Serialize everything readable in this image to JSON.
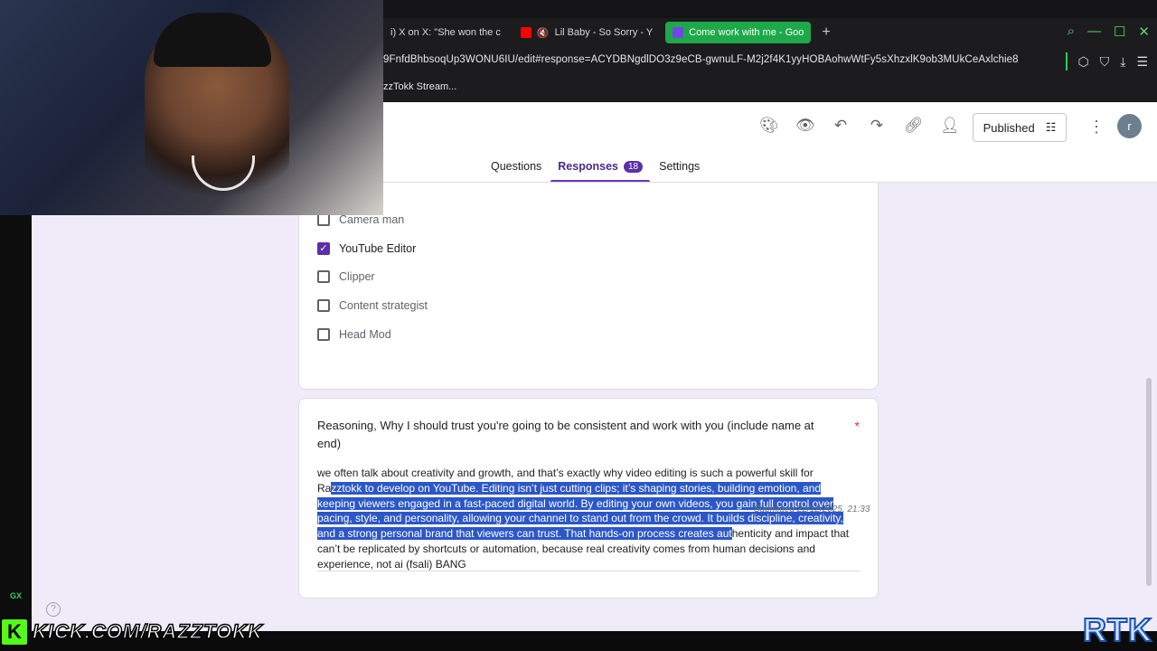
{
  "browser": {
    "tabs": [
      {
        "label": "i) X on X: \"She won the c",
        "active": false,
        "icon": "x-icon"
      },
      {
        "label": "Lil Baby - So Sorry - Y",
        "active": false,
        "icon": "youtube-icon",
        "muted": true
      },
      {
        "label": "Come work with me - Goo",
        "active": true,
        "icon": "forms-icon"
      }
    ],
    "new_tab": "+",
    "address": "9FnfdBhbsoqUp3WONU6IU/edit#response=ACYDBNgdlDO3z9eCB-gwnuLF-M2j2f4K1yyHOBAohwWtFy5sXhzxlK9ob3MUkCeAxlchie8",
    "bookmark": "zzTokk Stream...",
    "accent": "#1ea84a"
  },
  "form": {
    "published_label": "Published",
    "avatar_initial": "r",
    "tabs": [
      {
        "label": "Questions"
      },
      {
        "label": "Responses",
        "badge": "18",
        "active": true
      },
      {
        "label": "Settings"
      }
    ],
    "options": [
      {
        "label": "Camera man",
        "checked": false
      },
      {
        "label": "YouTube Editor",
        "checked": true
      },
      {
        "label": "Clipper",
        "checked": false
      },
      {
        "label": "Content strategist",
        "checked": false
      },
      {
        "label": "Head Mod",
        "checked": false
      }
    ],
    "question": "Reasoning, Why I should trust you're going to be consistent and work with you (include name at end)",
    "required_mark": "*",
    "answer_before": "we often talk about creativity and growth, and that’s exactly why video editing is such a powerful skill for Ra",
    "answer_selected": "zztokk to develop on YouTube. Editing isn’t just cutting clips; it’s shaping stories, building emotion, and keeping viewers engaged in a fast-paced digital world. By editing your own videos, you gain full control over pacing, style, and personality, allowing your channel to stand out from the crowd. It builds discipline, creativity, and a strong personal brand that viewers can trust. That hands-on process creates aut",
    "answer_after": "henticity and impact that can’t be replicated by shortcuts or automation, because real creativity comes from human decisions and experience, not ai (fsali) BANG",
    "submitted": "Submitted 22/12/2025, 21:33",
    "accent": "#673ab7"
  },
  "overlay": {
    "gx": "GX",
    "kick_text": "KICK.COM/RAZZTOKK",
    "kick_logo": "K",
    "rtk": "RTK"
  }
}
